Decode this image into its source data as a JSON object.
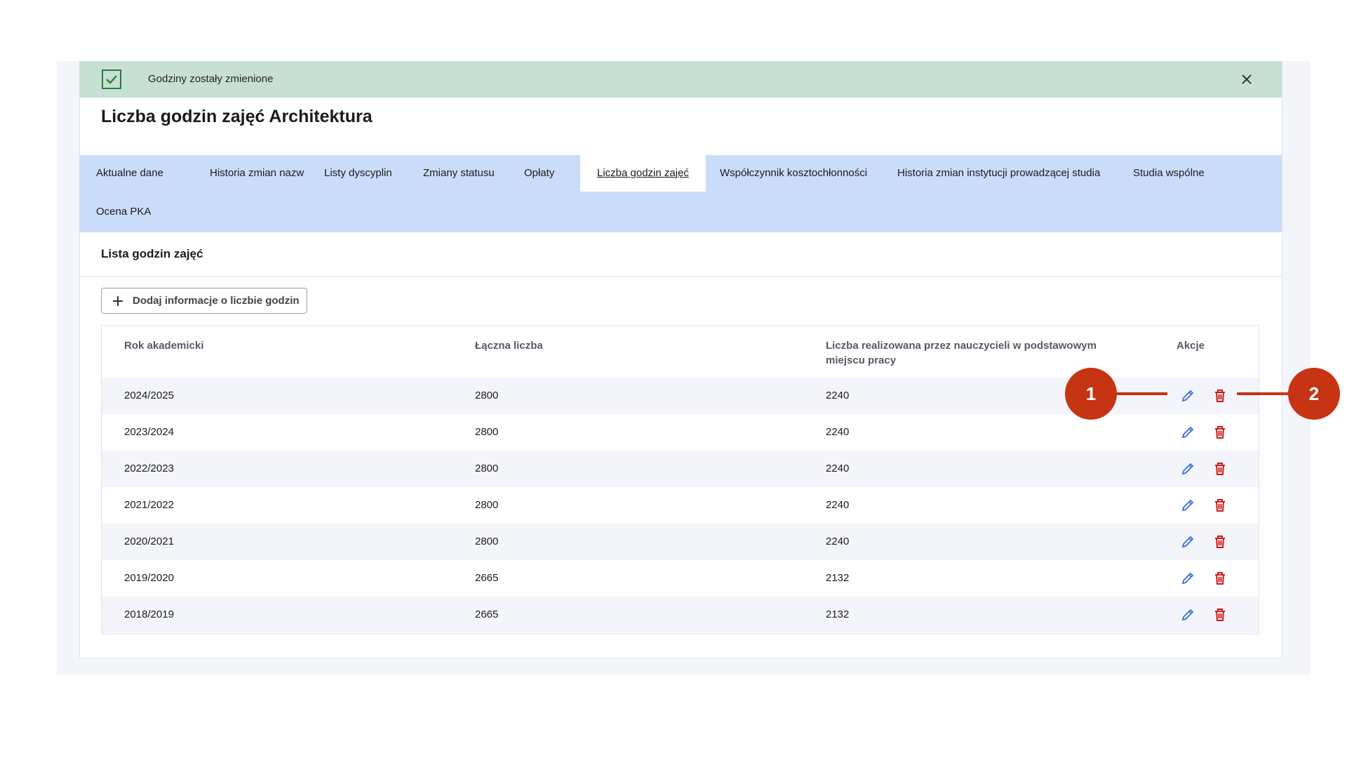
{
  "alert": {
    "message": "Godziny zostały zmienione"
  },
  "page": {
    "title": "Liczba godzin zajęć Architektura"
  },
  "tabs": [
    {
      "label": "Aktualne dane"
    },
    {
      "label": "Historia zmian nazw"
    },
    {
      "label": "Listy dyscyplin"
    },
    {
      "label": "Zmiany statusu"
    },
    {
      "label": "Opłaty"
    },
    {
      "label": "Liczba godzin zajęć",
      "active": true
    },
    {
      "label": "Współczynnik kosztochłonności"
    },
    {
      "label": "Historia zmian instytucji prowadzącej studia"
    },
    {
      "label": "Studia wspólne"
    },
    {
      "label": "Ocena PKA"
    }
  ],
  "section": {
    "title": "Lista godzin zajęć"
  },
  "toolbar": {
    "add_label": "Dodaj informacje o liczbie godzin"
  },
  "table": {
    "headers": {
      "year": "Rok akademicki",
      "total": "Łączna liczba",
      "primary": "Liczba realizowana przez nauczycieli w podstawowym miejscu pracy",
      "actions": "Akcje"
    },
    "rows": [
      {
        "year": "2024/2025",
        "total": "2800",
        "primary": "2240"
      },
      {
        "year": "2023/2024",
        "total": "2800",
        "primary": "2240"
      },
      {
        "year": "2022/2023",
        "total": "2800",
        "primary": "2240"
      },
      {
        "year": "2021/2022",
        "total": "2800",
        "primary": "2240"
      },
      {
        "year": "2020/2021",
        "total": "2800",
        "primary": "2240"
      },
      {
        "year": "2019/2020",
        "total": "2665",
        "primary": "2132"
      },
      {
        "year": "2018/2019",
        "total": "2665",
        "primary": "2132"
      }
    ]
  },
  "callouts": [
    "1",
    "2"
  ],
  "colors": {
    "alert_bg": "#c8e0d3",
    "tabs_bg": "#cbdcfb",
    "edit_icon": "#3b6fd8",
    "delete_icon": "#d11a1a",
    "callout": "#c73413"
  },
  "icons": {
    "alert": "check-icon",
    "close": "close-icon",
    "add": "plus-icon",
    "edit": "pencil-icon",
    "delete": "trash-icon"
  }
}
